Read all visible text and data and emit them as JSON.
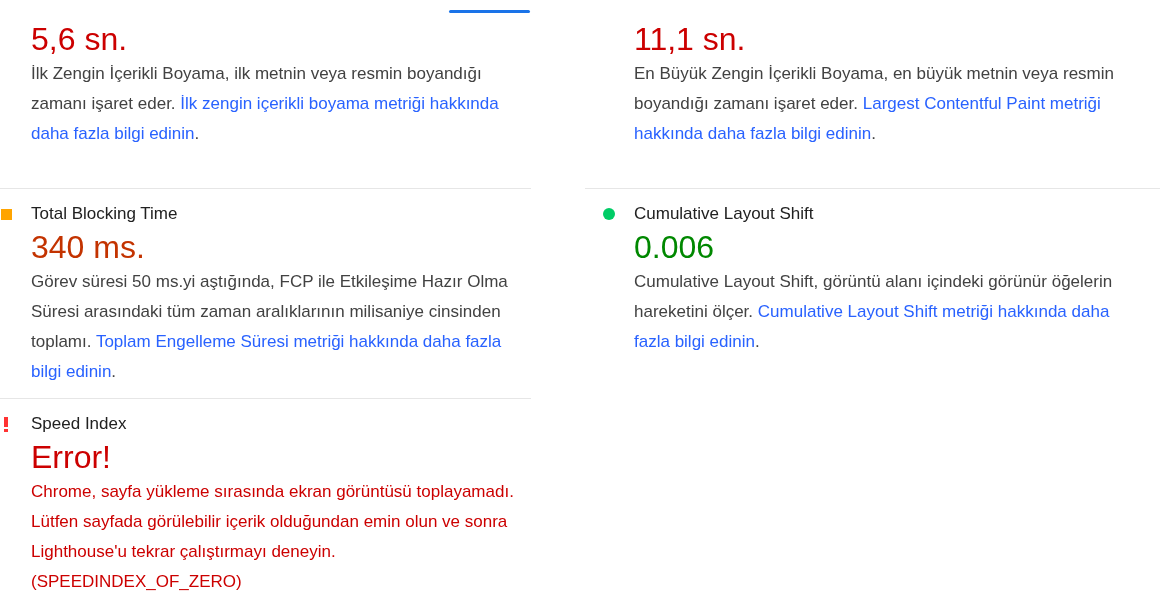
{
  "columns": [
    {
      "metrics": [
        {
          "kind": "fail",
          "value": "5,6 sn.",
          "text": "İlk Zengin İçerikli Boyama, ilk metnin veya resmin boyandığı zamanı işaret eder.",
          "link_lines": [
            "İlk zengin içerikli boyama metriği hakkında",
            "daha fazla bilgi edinin"
          ],
          "text_after": "."
        },
        {
          "title": "Total Blocking Time",
          "kind": "average",
          "value": "340 ms.",
          "text": "Görev süresi 50 ms.yi aştığında, FCP ile Etkileşime Hazır Olma Süresi arasındaki tüm zaman aralıklarının milisaniye cinsinden toplamı.",
          "link_lines": [
            "Toplam Engelleme Süresi metriği hakkında daha fazla",
            "bilgi edinin"
          ],
          "text_after": "."
        },
        {
          "title": "Speed Index",
          "kind": "error",
          "value": "Error!",
          "text": "Chrome, sayfa yükleme sırasında ekran görüntüsü toplayamadı. Lütfen sayfada görülebilir içerik olduğundan emin olun ve sonra Lighthouse'u tekrar çalıştırmayı deneyin. (SPEEDINDEX_OF_ZERO)"
        }
      ]
    },
    {
      "metrics": [
        {
          "kind": "fail",
          "value": "11,1 sn.",
          "text": "En Büyük Zengin İçerikli Boyama, en büyük metnin veya resmin boyandığı zamanı işaret eder.",
          "link_lines": [
            "Largest Contentful Paint metriği",
            "hakkında daha fazla bilgi edinin"
          ],
          "text_after": "."
        },
        {
          "title": "Cumulative Layout Shift",
          "kind": "pass",
          "value": "0.006",
          "text": "Cumulative Layout Shift, görüntü alanı içindeki görünür öğelerin hareketini ölçer.",
          "link_lines": [
            "Cumulative Layout Shift metriği hakkında daha",
            "fazla bilgi edinin"
          ],
          "text_after": "."
        }
      ]
    }
  ]
}
